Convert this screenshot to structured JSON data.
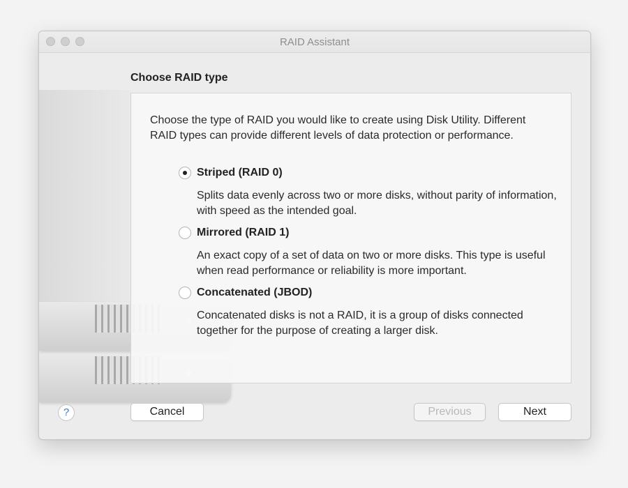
{
  "window": {
    "title": "RAID Assistant"
  },
  "page": {
    "heading": "Choose RAID type"
  },
  "intro": "Choose the type of RAID you would like to create using Disk Utility. Different RAID types can provide different levels of data protection or performance.",
  "options": [
    {
      "label": "Striped (RAID 0)",
      "selected": true,
      "description": "Splits data evenly across two or more disks, without parity of information, with speed as the intended goal."
    },
    {
      "label": "Mirrored (RAID 1)",
      "selected": false,
      "description": "An exact copy of a set of data on two or more disks. This type is useful when read performance or reliability is more important."
    },
    {
      "label": "Concatenated (JBOD)",
      "selected": false,
      "description": "Concatenated disks is not a RAID, it is a group of disks connected together for the purpose of creating a larger disk."
    }
  ],
  "buttons": {
    "help": "?",
    "cancel": "Cancel",
    "previous": "Previous",
    "next": "Next"
  },
  "icons": {
    "help": "question-mark",
    "disk_art": "hard-drive-stack"
  }
}
